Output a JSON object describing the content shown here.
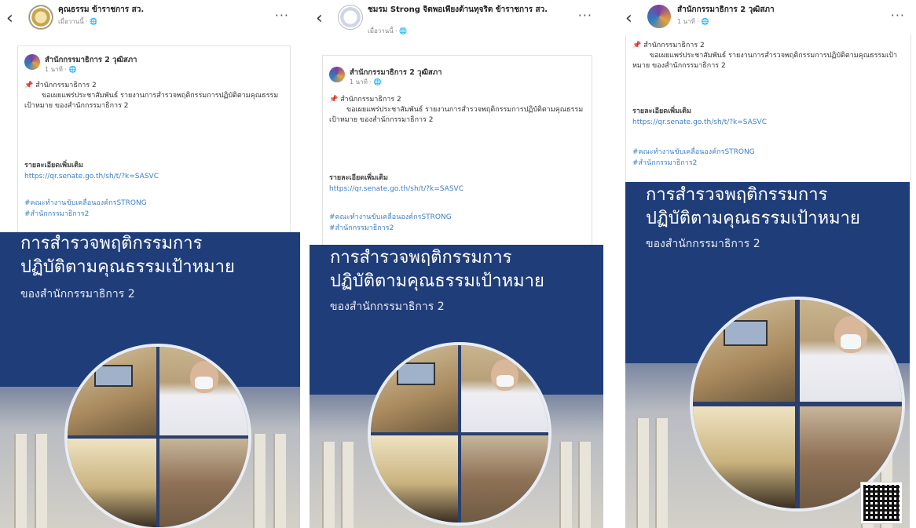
{
  "screens": [
    {
      "header": {
        "page_name": "คุณธรรม ข้าราชการ สว.",
        "time": "เมื่อวานนี้ · 🌐",
        "more": "···"
      },
      "post": {
        "author": "สำนักกรรมาธิการ 2 วุฒิสภา",
        "time": "1 นาที · 🌐",
        "pin": "📌",
        "line1": "สำนักกรรมาธิการ 2",
        "line2": "ขอเผยแพร่ประชาสัมพันธ์ รายงานการสำรวจพฤติกรรมการปฏิบัติตามคุณธรรมเป้าหมาย ของสำนักกรรมาธิการ 2",
        "detail_heading": "รายละเอียดเพิ่มเติม",
        "link": "https://qr.senate.go.th/sh/t/?k=SASVC",
        "tag1": "#คณะทำงานขับเคลื่อนองค์กรSTRONG",
        "tag2": "#สำนักกรรมาธิการ2"
      },
      "banner": {
        "title_line1": "การสำรวจพฤติกรรมการ",
        "title_line2": "ปฏิบัติตามคุณธรรมเป้าหมาย",
        "title_line3": "ของสำนักกรรมาธิการ 2"
      }
    },
    {
      "header": {
        "page_name": "ชมรม Strong จิตพอเพียงต้านทุจริต ข้าราชการ สว.",
        "time": "เมื่อวานนี้ · 🌐",
        "more": "···"
      },
      "post": {
        "author": "สำนักกรรมาธิการ 2 วุฒิสภา",
        "time": "1 นาที · 🌐",
        "pin": "📌",
        "line1": "สำนักกรรมาธิการ 2",
        "line2": "ขอเผยแพร่ประชาสัมพันธ์ รายงานการสำรวจพฤติกรรมการปฏิบัติตามคุณธรรมเป้าหมาย ของสำนักกรรมาธิการ 2",
        "detail_heading": "รายละเอียดเพิ่มเติม",
        "link": "https://qr.senate.go.th/sh/t/?k=SASVC",
        "tag1": "#คณะทำงานขับเคลื่อนองค์กรSTRONG",
        "tag2": "#สำนักกรรมาธิการ2"
      },
      "banner": {
        "title_line1": "การสำรวจพฤติกรรมการ",
        "title_line2": "ปฏิบัติตามคุณธรรมเป้าหมาย",
        "title_line3": "ของสำนักกรรมาธิการ 2"
      }
    },
    {
      "header": {
        "page_name": "สำนักกรรมาธิการ 2 วุฒิสภา",
        "time": "1 นาที · 🌐",
        "more": "···"
      },
      "post": {
        "pin": "📌",
        "line1": "สำนักกรรมาธิการ 2",
        "line2": "ขอเผยแพร่ประชาสัมพันธ์ รายงานการสำรวจพฤติกรรมการปฏิบัติตามคุณธรรมเป้าหมาย ของสำนักกรรมาธิการ 2",
        "detail_heading": "รายละเอียดเพิ่มเติม",
        "link": "https://qr.senate.go.th/sh/t/?k=SASVC",
        "tag1": "#คณะทำงานขับเคลื่อนองค์กรSTRONG",
        "tag2": "#สำนักกรรมาธิการ2"
      },
      "banner": {
        "title_line1": "การสำรวจพฤติกรรมการ",
        "title_line2": "ปฏิบัติตามคุณธรรมเป้าหมาย",
        "title_line3": "ของสำนักกรรมาธิการ 2"
      }
    }
  ],
  "colors": {
    "banner": "#1f3d79",
    "link": "#3b7fc4",
    "pin": "#d6302b"
  },
  "icons": {
    "back": "chevron-left-icon",
    "more": "more-horizontal-icon",
    "pin": "pushpin-icon"
  }
}
